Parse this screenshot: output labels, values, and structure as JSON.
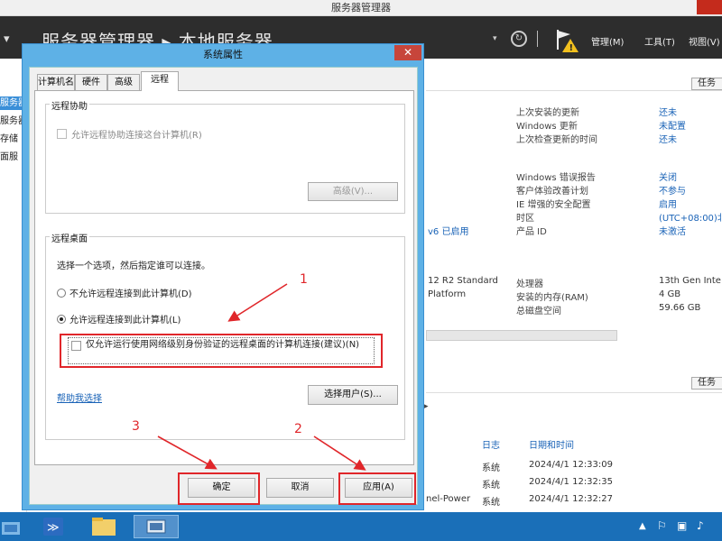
{
  "window_title": "服务器管理器",
  "header": {
    "breadcrumb_root": "服务器管理器",
    "breadcrumb_sep": "▸",
    "breadcrumb_current": "本地服务器",
    "menus": [
      "管理(M)",
      "工具(T)",
      "视图(V)"
    ]
  },
  "left_nav": [
    "服务器",
    "服务器",
    "存储",
    "面服"
  ],
  "tasks_label": "任务",
  "properties": {
    "col1_fragments": [
      "v6 已启用",
      "12 R2 Standard",
      "Platform"
    ],
    "group1": [
      {
        "label": "上次安装的更新",
        "value": "还未"
      },
      {
        "label": "Windows 更新",
        "value": "未配置"
      },
      {
        "label": "上次检查更新的时间",
        "value": "还未"
      }
    ],
    "group2": [
      {
        "label": "Windows 错误报告",
        "value": "关闭"
      },
      {
        "label": "客户体验改善计划",
        "value": "不参与"
      },
      {
        "label": "IE 增强的安全配置",
        "value": "启用"
      },
      {
        "label": "时区",
        "value": "(UTC+08:00)北"
      },
      {
        "label": "产品 ID",
        "value": "未激活"
      }
    ],
    "group3": [
      {
        "label": "处理器",
        "value": "13th Gen Inte"
      },
      {
        "label": "安装的内存(RAM)",
        "value": "4 GB"
      },
      {
        "label": "总磁盘空间",
        "value": "59.66 GB"
      }
    ]
  },
  "events": {
    "headers": [
      "日志",
      "日期和时间"
    ],
    "rows": [
      {
        "source": "",
        "log": "系统",
        "time": "2024/4/1 12:33:09"
      },
      {
        "source": "",
        "log": "系统",
        "time": "2024/4/1 12:32:35"
      },
      {
        "source": "nel-Power",
        "log": "系统",
        "time": "2024/4/1 12:32:27"
      }
    ]
  },
  "dialog": {
    "title": "系统属性",
    "close": "✕",
    "tabs": [
      "计算机名",
      "硬件",
      "高级",
      "远程"
    ],
    "assist_group": "远程协助",
    "assist_check": "允许远程协助连接这台计算机(R)",
    "advanced_btn": "高级(V)...",
    "desktop_group": "远程桌面",
    "desktop_prompt": "选择一个选项，然后指定谁可以连接。",
    "radio_deny": "不允许远程连接到此计算机(D)",
    "radio_allow": "允许远程连接到此计算机(L)",
    "nla_check": "仅允许运行使用网络级别身份验证的远程桌面的计算机连接(建议)(N)",
    "help_link": "帮助我选择",
    "select_users_btn": "选择用户(S)...",
    "ok_btn": "确定",
    "cancel_btn": "取消",
    "apply_btn": "应用(A)"
  },
  "annotations": [
    "1",
    "2",
    "3"
  ],
  "colors": {
    "annotation": "#e0262a",
    "dialog_frame": "#5eb1e6",
    "header_bg": "#2d2d2d",
    "taskbar": "#1a6fb8"
  }
}
